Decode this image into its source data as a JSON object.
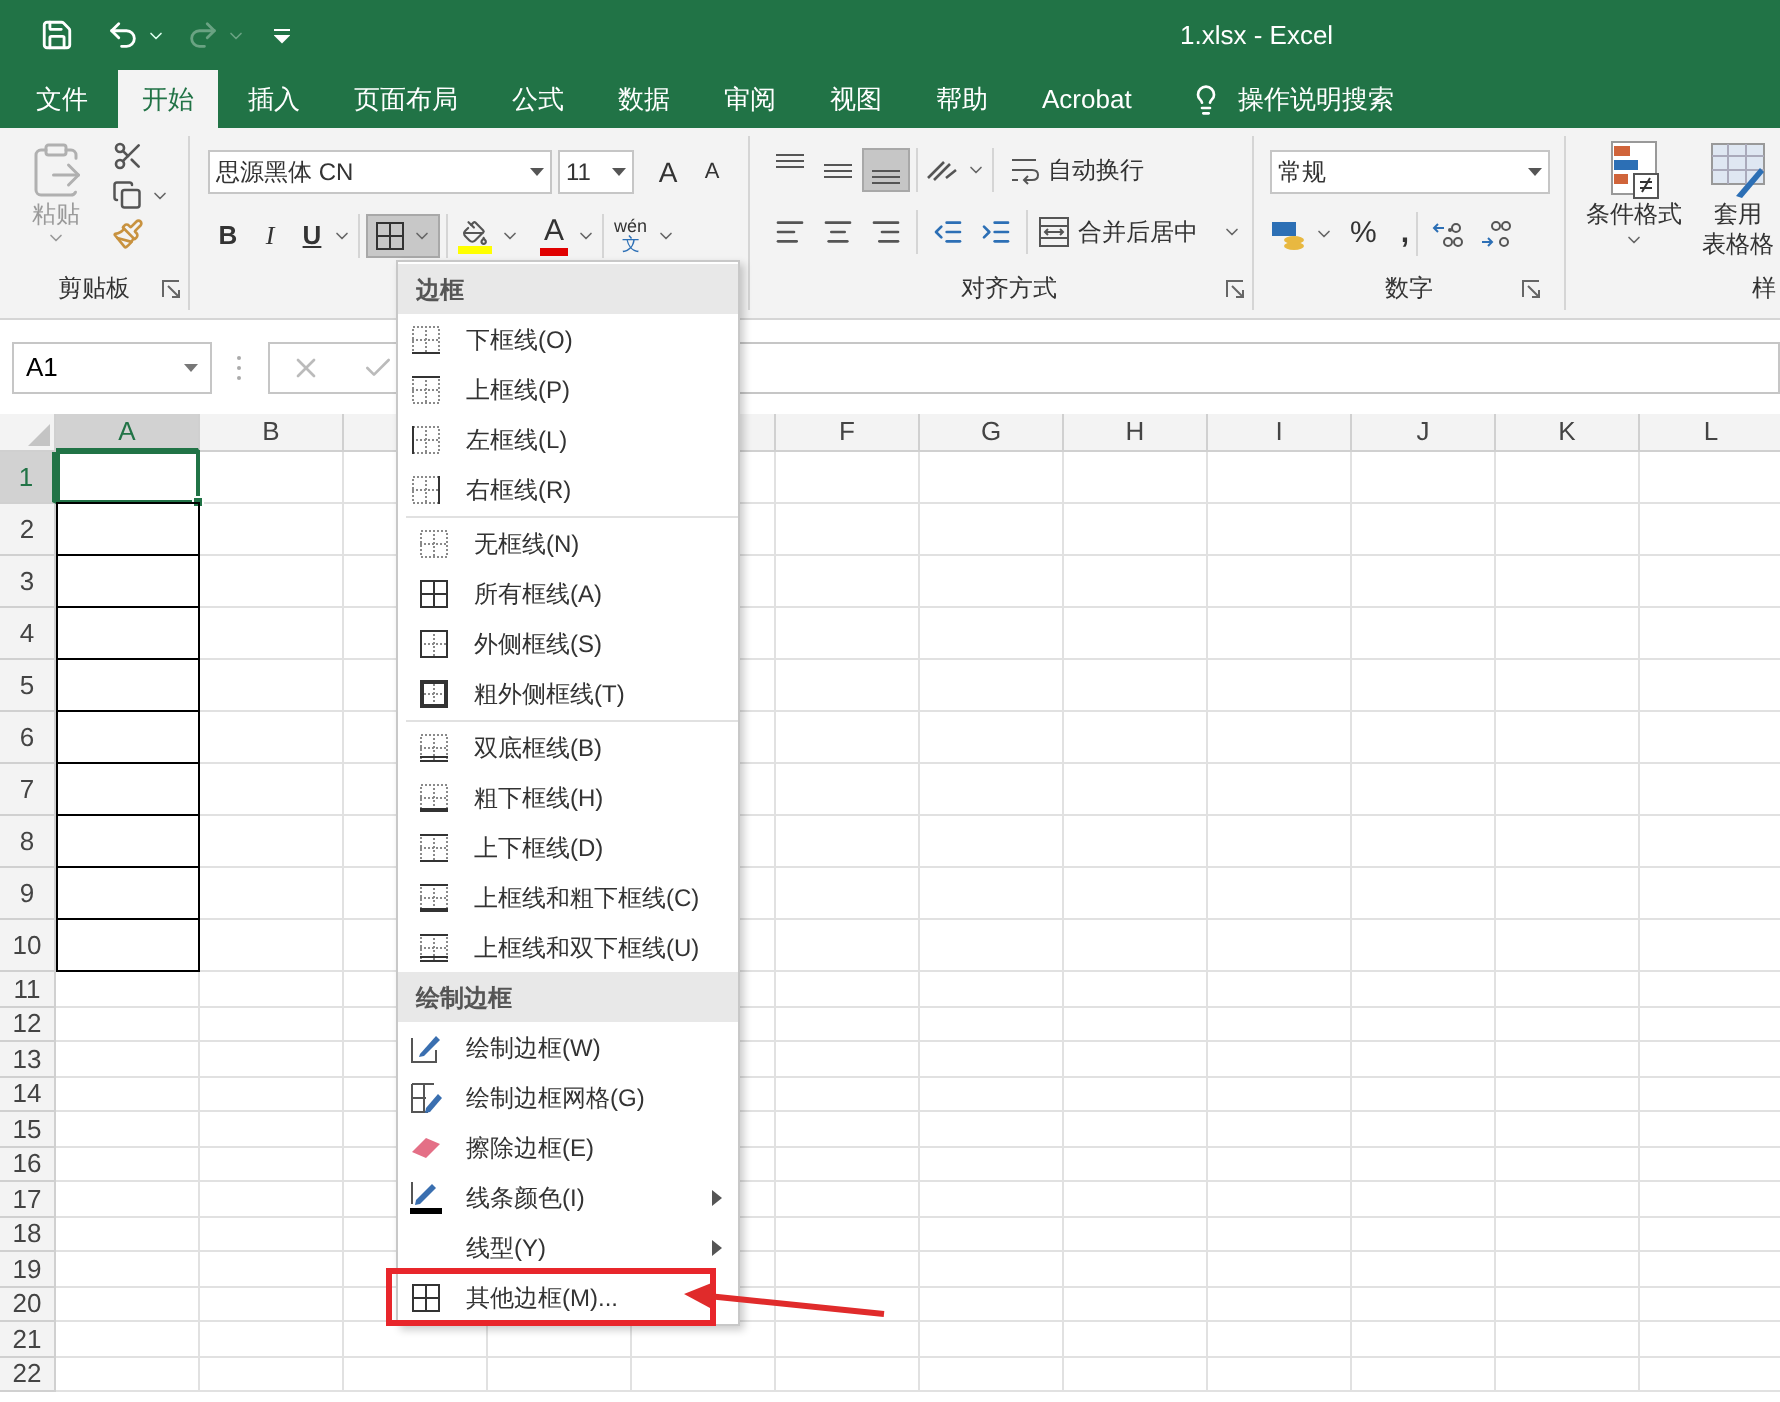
{
  "title_bar": {
    "title": "1.xlsx  -  Excel"
  },
  "tabs": [
    {
      "label": "文件",
      "selected": false
    },
    {
      "label": "开始",
      "selected": true
    },
    {
      "label": "插入",
      "selected": false
    },
    {
      "label": "页面布局",
      "selected": false
    },
    {
      "label": "公式",
      "selected": false
    },
    {
      "label": "数据",
      "selected": false
    },
    {
      "label": "审阅",
      "selected": false
    },
    {
      "label": "视图",
      "selected": false
    },
    {
      "label": "帮助",
      "selected": false
    },
    {
      "label": "Acrobat",
      "selected": false
    }
  ],
  "search": {
    "placeholder": "操作说明搜索"
  },
  "ribbon": {
    "clipboard": {
      "paste": "粘贴",
      "paste_disabled": true,
      "label": "剪贴板"
    },
    "font": {
      "font_name": "思源黑体 CN",
      "font_size": "11",
      "grow": "A",
      "shrink": "A",
      "bold": "B",
      "italic": "I",
      "underline": "U",
      "border_pressed": true,
      "font_color": "A",
      "phonetic_top": "wén",
      "phonetic_bottom": "文"
    },
    "alignment": {
      "vertical": [
        {
          "kind": "top",
          "selected": false
        },
        {
          "kind": "middle",
          "selected": false
        },
        {
          "kind": "bottom",
          "selected": true
        }
      ],
      "wrap": "自动换行",
      "merge": "合并后居中",
      "label": "对齐方式"
    },
    "number": {
      "format": "常规",
      "percent": "%",
      "comma": ",",
      "label": "数字"
    },
    "styles": {
      "conditional": "条件格式",
      "table_format_top": "套用",
      "table_format_bottom": "表格格",
      "label": "样"
    }
  },
  "formula_bar": {
    "name_box": "A1"
  },
  "sheet": {
    "columns": [
      {
        "label": "A",
        "selected": true
      },
      {
        "label": "B",
        "selected": false
      },
      {
        "label": "F",
        "selected": false
      },
      {
        "label": "G",
        "selected": false
      },
      {
        "label": "H",
        "selected": false
      },
      {
        "label": "I",
        "selected": false
      },
      {
        "label": "J",
        "selected": false
      },
      {
        "label": "K",
        "selected": false
      },
      {
        "label": "L",
        "selected": false
      }
    ],
    "rows": [
      {
        "label": "1",
        "selected": true,
        "bordered": true
      },
      {
        "label": "2",
        "selected": false,
        "bordered": true
      },
      {
        "label": "3",
        "selected": false,
        "bordered": true
      },
      {
        "label": "4",
        "selected": false,
        "bordered": true
      },
      {
        "label": "5",
        "selected": false,
        "bordered": true
      },
      {
        "label": "6",
        "selected": false,
        "bordered": true
      },
      {
        "label": "7",
        "selected": false,
        "bordered": true
      },
      {
        "label": "8",
        "selected": false,
        "bordered": true
      },
      {
        "label": "9",
        "selected": false,
        "bordered": true
      },
      {
        "label": "10",
        "selected": false,
        "bordered": true
      },
      {
        "label": "11",
        "selected": false,
        "bordered": false
      },
      {
        "label": "12",
        "selected": false,
        "bordered": false
      },
      {
        "label": "13",
        "selected": false,
        "bordered": false
      },
      {
        "label": "14",
        "selected": false,
        "bordered": false
      },
      {
        "label": "15",
        "selected": false,
        "bordered": false
      },
      {
        "label": "16",
        "selected": false,
        "bordered": false
      },
      {
        "label": "17",
        "selected": false,
        "bordered": false
      },
      {
        "label": "18",
        "selected": false,
        "bordered": false
      },
      {
        "label": "19",
        "selected": false,
        "bordered": false
      },
      {
        "label": "20",
        "selected": false,
        "bordered": false
      },
      {
        "label": "21",
        "selected": false,
        "bordered": false
      },
      {
        "label": "22",
        "selected": false,
        "bordered": false
      }
    ]
  },
  "border_menu": {
    "sections": [
      {
        "title": "边框",
        "groups": [
          [
            {
              "label": "下框线(O)",
              "kind": "bottom",
              "submenu": false,
              "highlighted": false
            },
            {
              "label": "上框线(P)",
              "kind": "top",
              "submenu": false,
              "highlighted": false
            },
            {
              "label": "左框线(L)",
              "kind": "left",
              "submenu": false,
              "highlighted": false
            },
            {
              "label": "右框线(R)",
              "kind": "right",
              "submenu": false,
              "highlighted": false
            }
          ],
          [
            {
              "label": "无框线(N)",
              "kind": "none",
              "submenu": false,
              "highlighted": false
            },
            {
              "label": "所有框线(A)",
              "kind": "all",
              "submenu": false,
              "highlighted": false
            },
            {
              "label": "外侧框线(S)",
              "kind": "outside",
              "submenu": false,
              "highlighted": false
            },
            {
              "label": "粗外侧框线(T)",
              "kind": "thick-outside",
              "submenu": false,
              "highlighted": false
            }
          ],
          [
            {
              "label": "双底框线(B)",
              "kind": "double-bottom",
              "submenu": false,
              "highlighted": false
            },
            {
              "label": "粗下框线(H)",
              "kind": "thick-bottom",
              "submenu": false,
              "highlighted": false
            },
            {
              "label": "上下框线(D)",
              "kind": "top-bottom",
              "submenu": false,
              "highlighted": false
            },
            {
              "label": "上框线和粗下框线(C)",
              "kind": "top-thick-bottom",
              "submenu": false,
              "highlighted": false
            },
            {
              "label": "上框线和双下框线(U)",
              "kind": "top-double-bottom",
              "submenu": false,
              "highlighted": false
            }
          ]
        ]
      },
      {
        "title": "绘制边框",
        "groups": [
          [
            {
              "label": "绘制边框(W)",
              "kind": "draw",
              "submenu": false,
              "highlighted": false
            },
            {
              "label": "绘制边框网格(G)",
              "kind": "draw-grid",
              "submenu": false,
              "highlighted": false
            },
            {
              "label": "擦除边框(E)",
              "kind": "erase",
              "submenu": false,
              "highlighted": false
            },
            {
              "label": "线条颜色(I)",
              "kind": "line-color",
              "submenu": true,
              "highlighted": false
            },
            {
              "label": "线型(Y)",
              "kind": "line-style",
              "submenu": true,
              "highlighted": false
            },
            {
              "label": "其他边框(M)...",
              "kind": "all",
              "submenu": false,
              "highlighted": true
            }
          ]
        ]
      }
    ]
  }
}
